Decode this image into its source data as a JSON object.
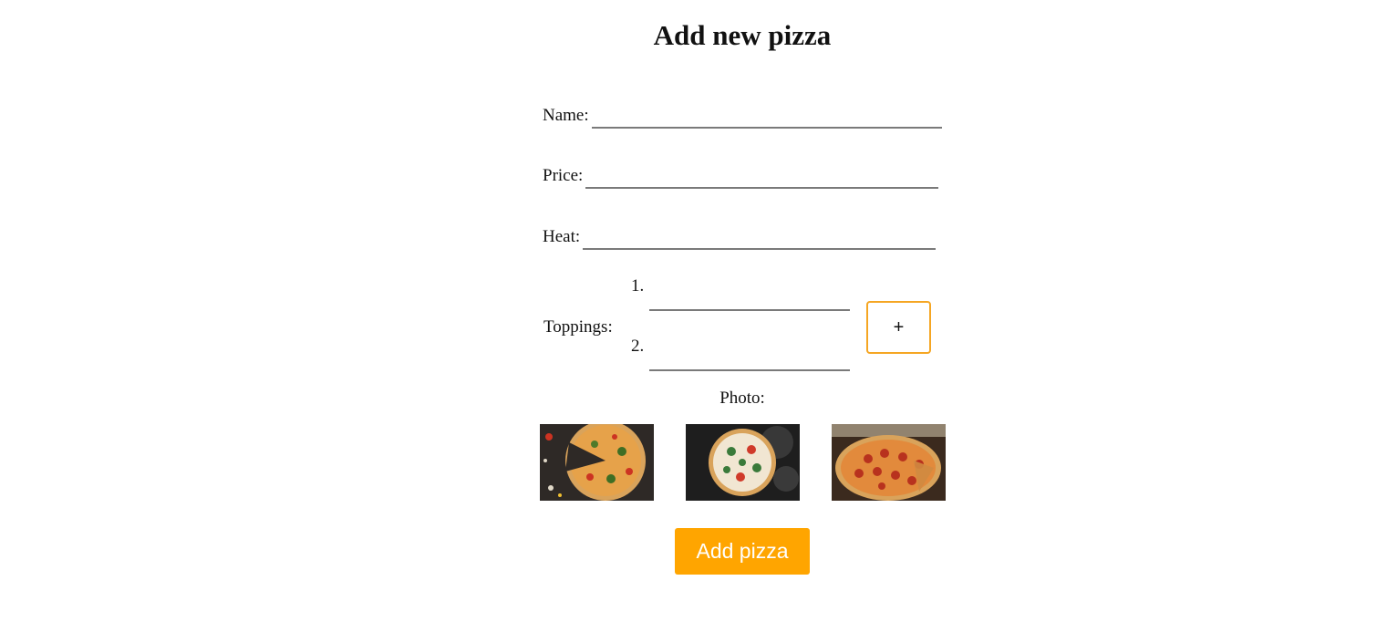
{
  "page": {
    "title": "Add new pizza"
  },
  "form": {
    "name_label": "Name:",
    "name_value": "",
    "price_label": "Price:",
    "price_value": "",
    "heat_label": "Heat:",
    "heat_value": "",
    "toppings_label": "Toppings:",
    "toppings": [
      {
        "number": "1.",
        "value": ""
      },
      {
        "number": "2.",
        "value": ""
      }
    ],
    "add_topping_label": "+",
    "photo_label": "Photo:",
    "photos": [
      {
        "icon": "pizza-with-slice-cut-photo"
      },
      {
        "icon": "margherita-pizza-on-dark-photo"
      },
      {
        "icon": "pepperoni-pizza-photo"
      }
    ],
    "submit_label": "Add pizza"
  },
  "colors": {
    "accent": "#ffa500",
    "accent_border": "#f5a623",
    "input_underline": "#7a7a7a"
  }
}
